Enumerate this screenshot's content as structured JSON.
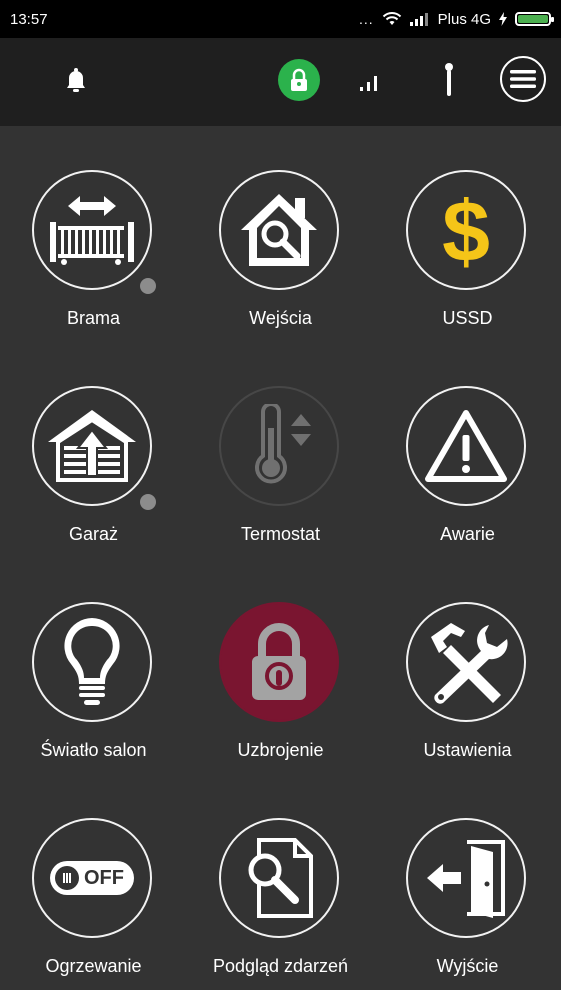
{
  "status_bar": {
    "time": "13:57",
    "dots": "...",
    "carrier": "Plus 4G",
    "battery_color": "#4caf50"
  },
  "toolbar": {
    "notifications_icon": "bell-icon",
    "lock_icon": "lock-icon",
    "lock_color": "#2bb24c",
    "signal_icon": "signal-bars-icon",
    "antenna_icon": "antenna-icon",
    "menu_icon": "hamburger-menu-icon"
  },
  "tiles": [
    {
      "label": "Brama",
      "icon": "gate-icon"
    },
    {
      "label": "Wejścia",
      "icon": "house-search-icon"
    },
    {
      "label": "USSD",
      "icon": "dollar-icon"
    },
    {
      "label": "Garaż",
      "icon": "garage-icon"
    },
    {
      "label": "Termostat",
      "icon": "thermometer-icon"
    },
    {
      "label": "Awarie",
      "icon": "warning-triangle-icon"
    },
    {
      "label": "Światło salon",
      "icon": "light-bulb-icon"
    },
    {
      "label": "Uzbrojenie",
      "icon": "padlock-icon"
    },
    {
      "label": "Ustawienia",
      "icon": "tools-icon"
    },
    {
      "label": "Ogrzewanie",
      "icon": "toggle-off-icon",
      "toggle_text": "OFF"
    },
    {
      "label": "Podgląd zdarzeń",
      "icon": "document-search-icon"
    },
    {
      "label": "Wyjście",
      "icon": "exit-door-icon"
    }
  ],
  "colors": {
    "background": "#333333",
    "toolbar": "#1f1f1f",
    "armed": "#7a1530",
    "ussd_gold": "#f5c518"
  }
}
